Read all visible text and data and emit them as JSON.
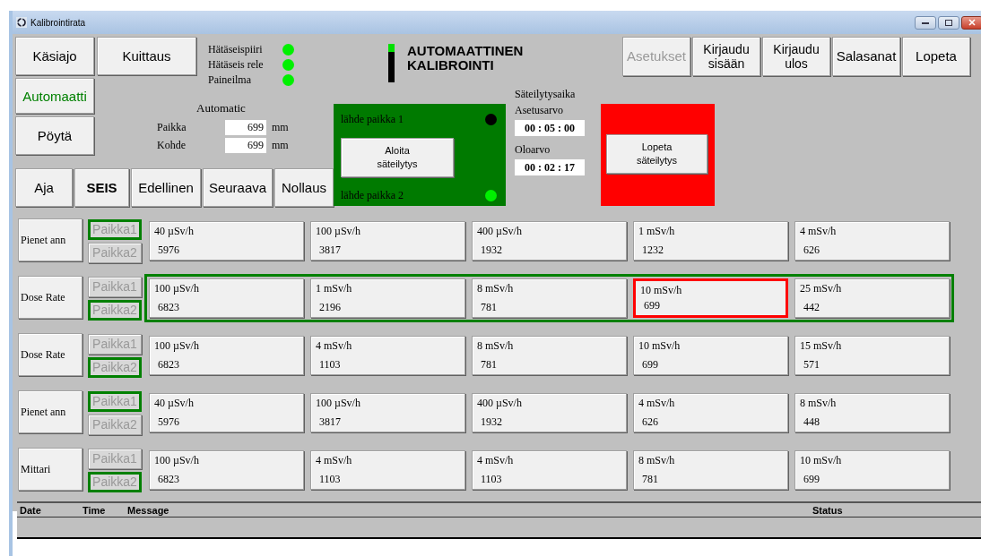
{
  "window": {
    "title": "Kalibrointirata"
  },
  "mode_buttons": [
    {
      "label": "Käsiajo",
      "selected": false
    },
    {
      "label": "Automaatti",
      "selected": true
    },
    {
      "label": "Pöytä",
      "selected": false
    }
  ],
  "ack_button": {
    "label": "Kuittaus"
  },
  "indicators": [
    {
      "label": "Hätäseispiiri",
      "on": true
    },
    {
      "label": "Hätäseis rele",
      "on": true
    },
    {
      "label": "Paineilma",
      "on": true
    }
  ],
  "mode_label": "Automatic",
  "position_fields": [
    {
      "label": "Paikka",
      "value": "699",
      "unit": "mm"
    },
    {
      "label": "Kohde",
      "value": "699",
      "unit": "mm"
    }
  ],
  "nav_buttons": [
    {
      "label": "Aja",
      "bold": false
    },
    {
      "label": "SEIS",
      "bold": true
    },
    {
      "label": "Edellinen",
      "bold": false
    },
    {
      "label": "Seuraava",
      "bold": false
    },
    {
      "label": "Nollaus",
      "bold": false
    }
  ],
  "heading": {
    "lines": [
      "AUTOMAATTINEN",
      "KALIBROINTI"
    ],
    "level": 0.2
  },
  "source_panel": {
    "sources": [
      {
        "label": "lähde paikka 1",
        "on": false
      },
      {
        "label": "lähde paikka 2",
        "on": true
      }
    ],
    "button": {
      "lines": [
        "Aloita",
        "säteilytys"
      ]
    }
  },
  "timer": {
    "title": "Säteilytysaika",
    "setpoint_label": "Asetusarvo",
    "setpoint": "00 : 05 : 00",
    "actual_label": "Oloarvo",
    "actual": "00 : 02 : 17"
  },
  "stop_panel": {
    "button": {
      "lines": [
        "Lopeta",
        "säteilytys"
      ]
    }
  },
  "top_buttons": [
    {
      "lines": [
        "Asetukset"
      ],
      "disabled": true
    },
    {
      "lines": [
        "Kirjaudu",
        "sisään"
      ],
      "disabled": false
    },
    {
      "lines": [
        "Kirjaudu",
        "ulos"
      ],
      "disabled": false
    },
    {
      "lines": [
        "Salasanat"
      ],
      "disabled": false
    },
    {
      "lines": [
        "Lopeta"
      ],
      "disabled": false
    }
  ],
  "rows": [
    {
      "label": "Pienet ann",
      "active": false,
      "positions": [
        {
          "label": "Paikka1",
          "selected": true
        },
        {
          "label": "Paikka2",
          "selected": false
        }
      ],
      "cells": [
        {
          "rate": "40 µSv/h",
          "count": "5976",
          "selected": false
        },
        {
          "rate": "100 µSv/h",
          "count": "3817",
          "selected": false
        },
        {
          "rate": "400 µSv/h",
          "count": "1932",
          "selected": false
        },
        {
          "rate": "1 mSv/h",
          "count": "1232",
          "selected": false
        },
        {
          "rate": "4 mSv/h",
          "count": "626",
          "selected": false
        }
      ]
    },
    {
      "label": "Dose Rate",
      "active": true,
      "positions": [
        {
          "label": "Paikka1",
          "selected": false
        },
        {
          "label": "Paikka2",
          "selected": true
        }
      ],
      "cells": [
        {
          "rate": "100 µSv/h",
          "count": "6823",
          "selected": false
        },
        {
          "rate": "1 mSv/h",
          "count": "2196",
          "selected": false
        },
        {
          "rate": "8 mSv/h",
          "count": "781",
          "selected": false
        },
        {
          "rate": "10 mSv/h",
          "count": "699",
          "selected": true
        },
        {
          "rate": "25 mSv/h",
          "count": "442",
          "selected": false
        }
      ]
    },
    {
      "label": "Dose Rate",
      "active": false,
      "positions": [
        {
          "label": "Paikka1",
          "selected": false
        },
        {
          "label": "Paikka2",
          "selected": true
        }
      ],
      "cells": [
        {
          "rate": "100 µSv/h",
          "count": "6823",
          "selected": false
        },
        {
          "rate": "4 mSv/h",
          "count": "1103",
          "selected": false
        },
        {
          "rate": "8 mSv/h",
          "count": "781",
          "selected": false
        },
        {
          "rate": "10 mSv/h",
          "count": "699",
          "selected": false
        },
        {
          "rate": "15 mSv/h",
          "count": "571",
          "selected": false
        }
      ]
    },
    {
      "label": "Pienet ann",
      "active": false,
      "positions": [
        {
          "label": "Paikka1",
          "selected": true
        },
        {
          "label": "Paikka2",
          "selected": false
        }
      ],
      "cells": [
        {
          "rate": "40 µSv/h",
          "count": "5976",
          "selected": false
        },
        {
          "rate": "100 µSv/h",
          "count": "3817",
          "selected": false
        },
        {
          "rate": "400 µSv/h",
          "count": "1932",
          "selected": false
        },
        {
          "rate": "4 mSv/h",
          "count": "626",
          "selected": false
        },
        {
          "rate": "8 mSv/h",
          "count": "448",
          "selected": false
        }
      ]
    },
    {
      "label": "Mittari",
      "active": false,
      "positions": [
        {
          "label": "Paikka1",
          "selected": false
        },
        {
          "label": "Paikka2",
          "selected": true
        }
      ],
      "cells": [
        {
          "rate": "100 µSv/h",
          "count": "6823",
          "selected": false
        },
        {
          "rate": "4 mSv/h",
          "count": "1103",
          "selected": false
        },
        {
          "rate": "4 mSv/h",
          "count": "1103",
          "selected": false
        },
        {
          "rate": "8 mSv/h",
          "count": "781",
          "selected": false
        },
        {
          "rate": "10 mSv/h",
          "count": "699",
          "selected": false
        }
      ]
    }
  ],
  "log": {
    "columns": [
      "Date",
      "Time",
      "Message",
      "Status"
    ]
  }
}
